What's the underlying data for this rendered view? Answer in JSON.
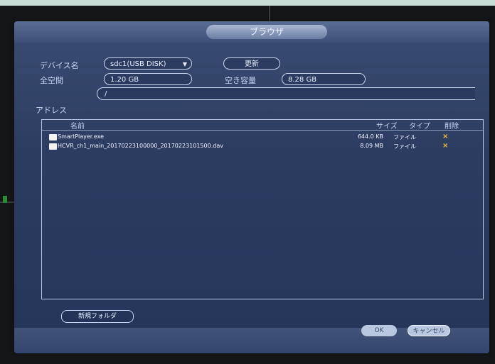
{
  "dialog": {
    "title": "ブラウザ",
    "device_label": "デバイス名",
    "device_value": "sdc1(USB DISK)",
    "refresh_label": "更新",
    "total_label": "全空間",
    "total_value": "1.20 GB",
    "free_label": "空き容量",
    "free_value": "8.28 GB",
    "address_label": "アドレス",
    "address_value": "/",
    "columns": {
      "name": "名前",
      "size": "サイズ",
      "type": "タイプ",
      "delete": "削除"
    },
    "files": [
      {
        "name": "SmartPlayer.exe",
        "size": "644.0 KB",
        "type": "ファイル",
        "delete": "×"
      },
      {
        "name": "HCVR_ch1_main_20170223100000_20170223101500.dav",
        "size": "8.09 MB",
        "type": "ファイル",
        "delete": "×"
      }
    ],
    "new_folder_label": "新規フォルダ",
    "ok_label": "OK",
    "cancel_label": "キャンセル"
  },
  "colors": {
    "dialog_bg": "#2c3c61",
    "accent_delete": "#f2c12e",
    "text_light": "#c6d4f2"
  },
  "icons": {
    "dropdown": "caret-down-icon",
    "file": "file-icon",
    "delete": "delete-x-icon"
  }
}
